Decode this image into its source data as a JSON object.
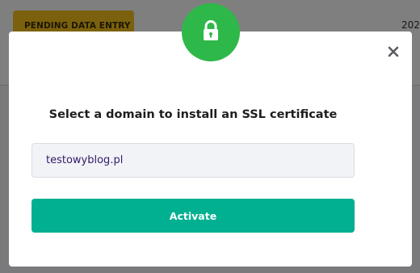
{
  "background": {
    "status_badge": "PENDING DATA ENTRY",
    "year_fragment": "202"
  },
  "modal": {
    "icon": "lock-icon",
    "close_icon": "close-icon",
    "title": "Select a domain to install an SSL certificate",
    "domain_select": {
      "selected_value": "testowyblog.pl"
    },
    "activate_label": "Activate"
  },
  "colors": {
    "lock_circle": "#2eb84a",
    "activate_button": "#00b090",
    "badge": "#f7c31c"
  }
}
